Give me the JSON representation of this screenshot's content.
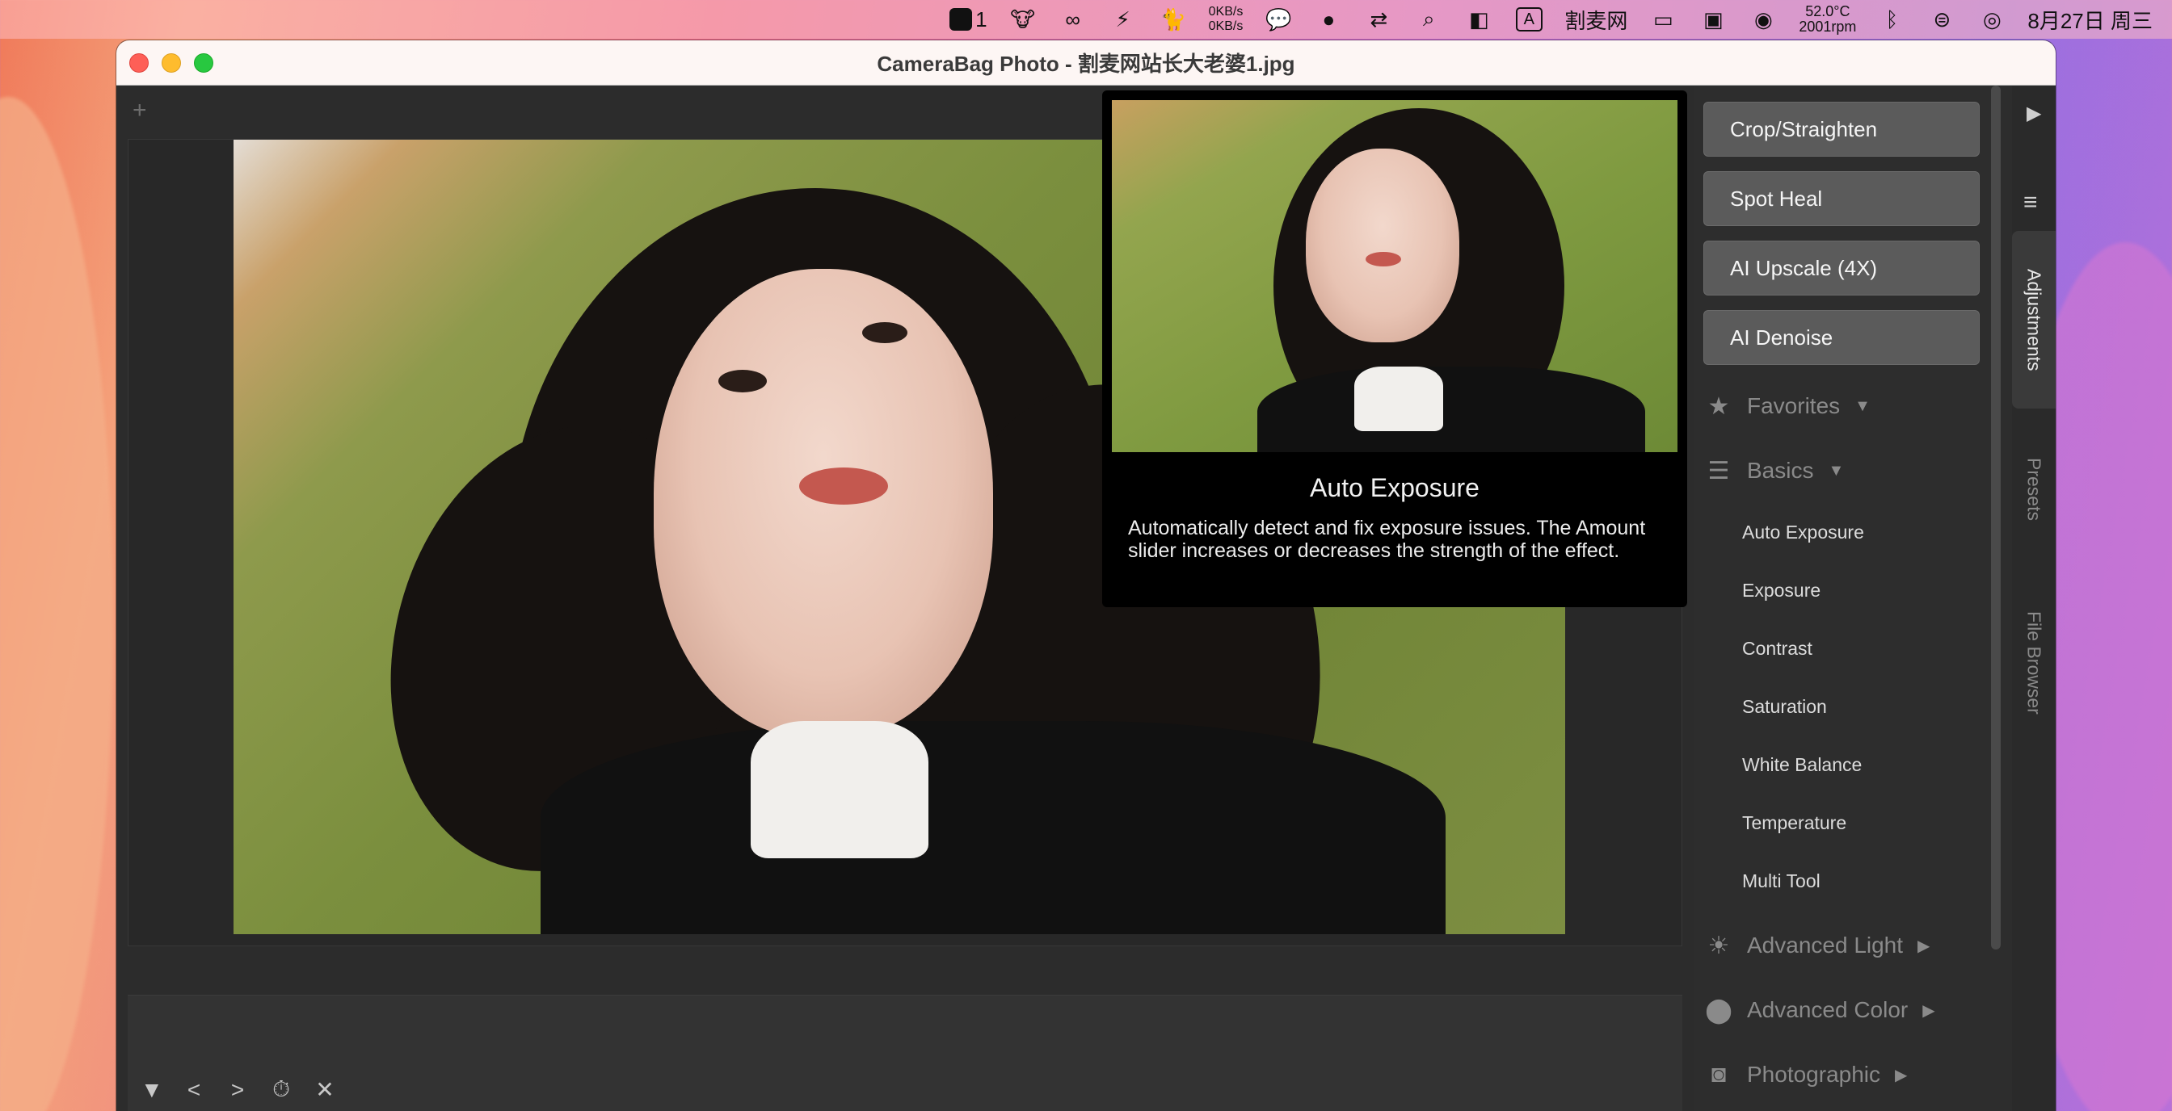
{
  "menubar": {
    "app_badge": "1",
    "net_up": "0KB/s",
    "net_down": "0KB/s",
    "input_method": "A",
    "site_name": "割麦网",
    "temperature": "52.0°C",
    "fan_speed": "2001rpm",
    "datetime": "8月27日 周三"
  },
  "window": {
    "title": "CameraBag Photo - 割麦网站长大老婆1.jpg",
    "add_label": "+"
  },
  "tooltip": {
    "title": "Auto Exposure",
    "description": "Automatically detect and fix exposure issues. The Amount slider increases or decreases the strength of the effect."
  },
  "panel": {
    "buttons": [
      "Crop/Straighten",
      "Spot Heal",
      "AI Upscale (4X)",
      "AI Denoise"
    ],
    "sections": {
      "favorites": "Favorites",
      "basics": "Basics",
      "advanced_light": "Advanced Light",
      "advanced_color": "Advanced Color",
      "photographic": "Photographic"
    },
    "basics_items": [
      "Auto Exposure",
      "Exposure",
      "Contrast",
      "Saturation",
      "White Balance",
      "Temperature",
      "Multi Tool"
    ]
  },
  "sidetabs": {
    "adjustments": "Adjustments",
    "presets": "Presets",
    "file_browser": "File Browser"
  },
  "bottom_controls": {
    "collapse": "▼",
    "prev": "<",
    "next": ">",
    "history": "⏱",
    "close": "✕"
  }
}
